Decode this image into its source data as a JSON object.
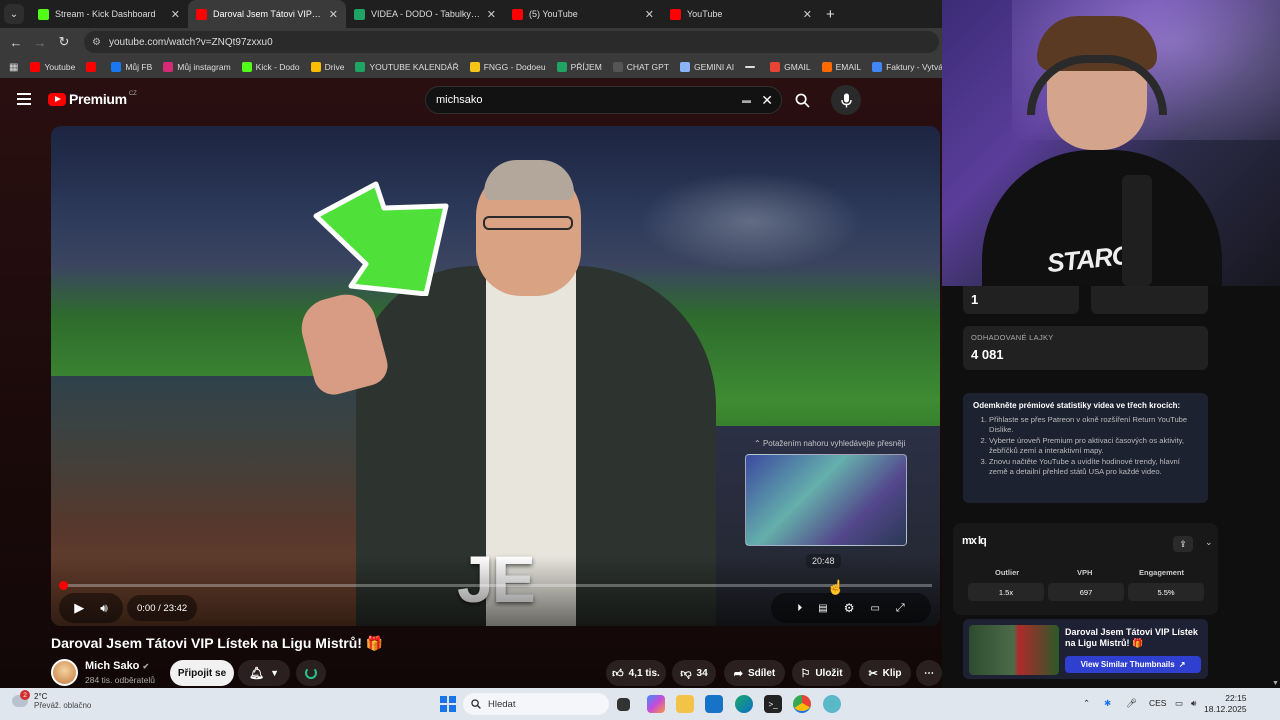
{
  "tabs": [
    {
      "title": "Stream - Kick Dashboard",
      "active": false,
      "color": "#53fc18"
    },
    {
      "title": "Daroval Jsem Tátovi VIP Lístek na",
      "active": true,
      "color": "#ff0000"
    },
    {
      "title": "VIDEA - DODO - Tabulky Google",
      "active": false,
      "color": "#1fa463"
    },
    {
      "title": "(5) YouTube",
      "active": false,
      "color": "#ff0000"
    },
    {
      "title": "YouTube",
      "active": false,
      "color": "#ff0000"
    }
  ],
  "address": {
    "url": "youtube.com/watch?v=ZNQt97zxxu0"
  },
  "bookmarks": [
    {
      "label": "Youtube",
      "color": "#ff0000"
    },
    {
      "label": "",
      "color": "#ff0000"
    },
    {
      "label": "Můj FB",
      "color": "#1877f2"
    },
    {
      "label": "Můj instagram",
      "color": "#d62976"
    },
    {
      "label": "Kick - Dodo",
      "color": "#53fc18"
    },
    {
      "label": "Drive",
      "color": "#fbbc04"
    },
    {
      "label": "YOUTUBE KALENDÁŘ",
      "color": "#1fa463"
    },
    {
      "label": "FNGG - Dodoeu",
      "color": "#f5c518"
    },
    {
      "label": "PŘÍJEM",
      "color": "#1fa463"
    },
    {
      "label": "CHAT GPT",
      "color": "#555555"
    },
    {
      "label": "GEMINI AI",
      "color": "#8ab4f8"
    },
    {
      "label": "",
      "color": "#dddddd"
    },
    {
      "label": "GMAIL",
      "color": "#ea4335"
    },
    {
      "label": "EMAIL",
      "color": "#ff6a00"
    },
    {
      "label": "Faktury - Vytváření",
      "color": "#4285f4"
    },
    {
      "label": "P",
      "color": "#e53935"
    }
  ],
  "youtube": {
    "logo_text": "Premium",
    "logo_region": "CZ",
    "search_value": "michsako"
  },
  "video": {
    "overlay_text": "JE",
    "seek_hint": "Potažením nahoru vyhledávejte přesněji",
    "preview_time": "20:48",
    "time_display": "0:00 / 23:42",
    "progress_fraction": 0.004,
    "title": "Daroval Jsem Tátovi VIP Lístek na Ligu Mistrů! 🎁"
  },
  "channel": {
    "name": "Mich Sako",
    "subscribers": "284 tis. odběratelů",
    "join_label": "Připojit se"
  },
  "actions": {
    "likes": "4,1 tis.",
    "dislikes": "34",
    "share": "Sdílet",
    "save": "Uložit",
    "clip": "Klip"
  },
  "stats": {
    "top_value": "1",
    "likes_label": "ODHADOVANÉ LAJKY",
    "likes_value": "4 081"
  },
  "promo": {
    "heading": "Odemkněte prémiové statistiky videa ve třech krocích:",
    "steps": [
      "Přihlaste se přes Patreon v okně rozšíření Return YouTube Dislike.",
      "Vyberte úroveň Premium pro aktivaci časových os aktivity, žebříčků zemí a interaktivní mapy.",
      "Znovu načtěte YouTube a uvidíte hodinové trendy, hlavní země a detailní přehled států USA pro každé video."
    ]
  },
  "extension": {
    "logo": "mx lq",
    "headers": [
      "Outlier",
      "VPH",
      "Engagement"
    ],
    "values": [
      "1.5x",
      "697",
      "5.5%"
    ]
  },
  "similar": {
    "title": "Daroval Jsem Tátovi VIP Lístek na Ligu Mistrů! 🎁",
    "button": "View Similar Thumbnails"
  },
  "webcam": {
    "shirt_text": "STARGA"
  },
  "taskbar": {
    "weather_badge": "2",
    "temp": "2°C",
    "weather": "Převáž. oblačno",
    "search_placeholder": "Hledat",
    "lang": "CES",
    "time": "22:15",
    "date": "18.12.2025"
  }
}
